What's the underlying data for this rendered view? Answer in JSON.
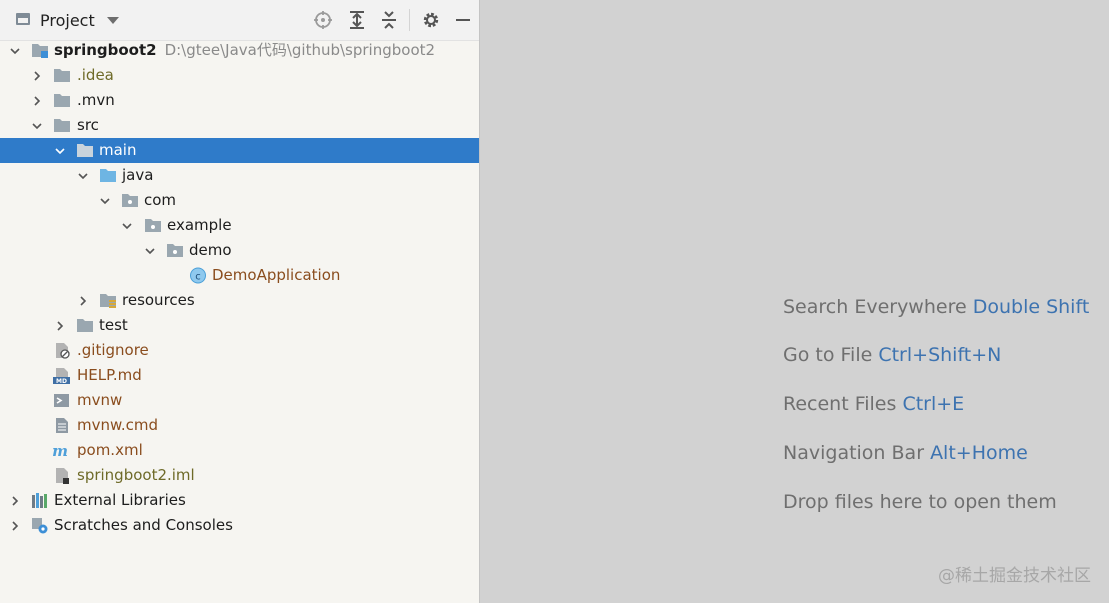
{
  "toolbar": {
    "title": "Project",
    "icons": [
      "locate-icon",
      "expand-all-icon",
      "collapse-all-icon",
      "gear-icon",
      "minimize-icon"
    ]
  },
  "tree": {
    "root": {
      "label": "springboot2",
      "path": "D:\\gtee\\Java代码\\github\\springboot2"
    },
    "items": [
      {
        "label": ".idea"
      },
      {
        "label": ".mvn"
      },
      {
        "label": "src"
      },
      {
        "label": "main"
      },
      {
        "label": "java"
      },
      {
        "label": "com"
      },
      {
        "label": "example"
      },
      {
        "label": "demo"
      },
      {
        "label": "DemoApplication"
      },
      {
        "label": "resources"
      },
      {
        "label": "test"
      },
      {
        "label": ".gitignore"
      },
      {
        "label": "HELP.md"
      },
      {
        "label": "mvnw"
      },
      {
        "label": "mvnw.cmd"
      },
      {
        "label": "pom.xml"
      },
      {
        "label": "springboot2.iml"
      },
      {
        "label": "External Libraries"
      },
      {
        "label": "Scratches and Consoles"
      }
    ],
    "selected": "main"
  },
  "editor_hints": [
    {
      "text": "Search Everywhere",
      "key": "Double Shift"
    },
    {
      "text": "Go to File",
      "key": "Ctrl+Shift+N"
    },
    {
      "text": "Recent Files",
      "key": "Ctrl+E"
    },
    {
      "text": "Navigation Bar",
      "key": "Alt+Home"
    },
    {
      "text": "Drop files here to open them",
      "key": ""
    }
  ],
  "watermark": "@稀土掘金技术社区",
  "colors": {
    "selection": "#2f7bc9",
    "hint_key": "#3d73b0",
    "folder": "#9aa7b0",
    "source_folder": "#6eb5e3"
  }
}
